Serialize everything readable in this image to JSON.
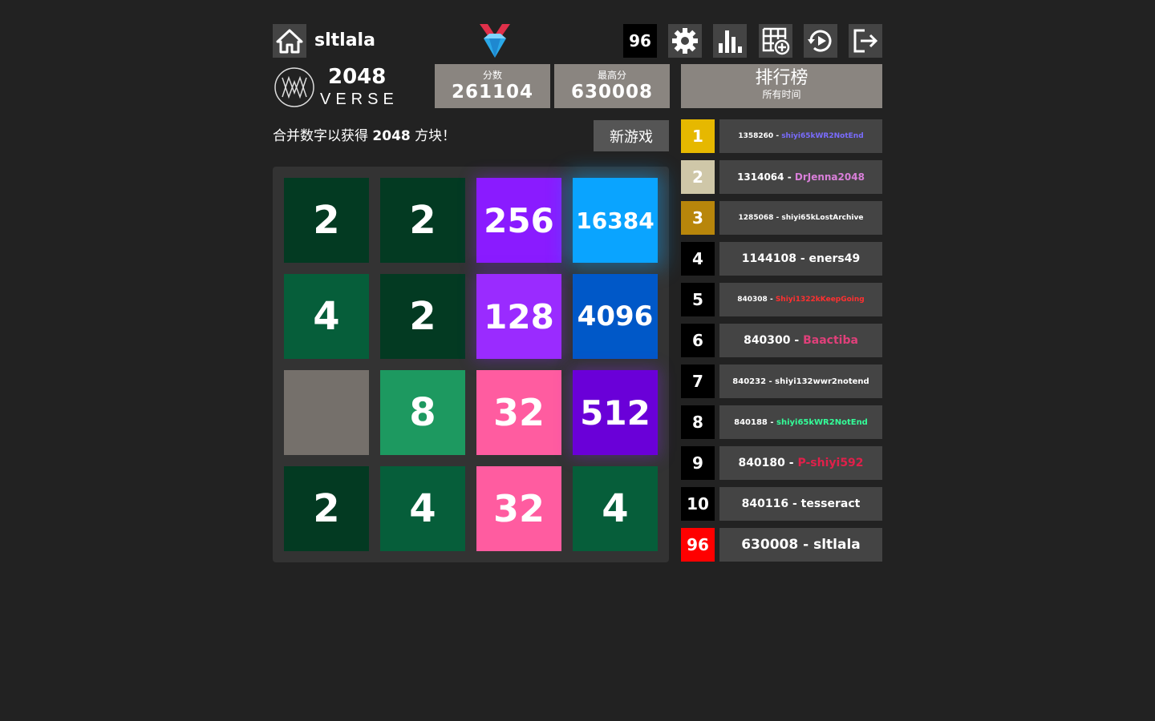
{
  "header": {
    "username": "sltlala",
    "rank_badge": "96",
    "icons": [
      "home-icon",
      "medal-diamond-icon",
      "gear-icon",
      "stats-bars-icon",
      "grid-add-icon",
      "replay-icon",
      "logout-icon"
    ]
  },
  "logo": {
    "line1": "2048",
    "line2": "VERSE"
  },
  "score": {
    "label": "分数",
    "value": "261104"
  },
  "best": {
    "label": "最高分",
    "value": "630008"
  },
  "leaderboard": {
    "title": "排行榜",
    "subtitle": "所有时间",
    "entries": [
      {
        "rank": "1",
        "score": "1358260 - ",
        "name": "shiyi65kWR2NotEnd",
        "rank_bg": "#e6b800",
        "name_color": "#7a6cff",
        "size": 9
      },
      {
        "rank": "2",
        "score": "1314064 - ",
        "name": "DrJenna2048",
        "rank_bg": "#cfc7a8",
        "name_color": "#d97fd9",
        "size": 12
      },
      {
        "rank": "3",
        "score": "1285068 - ",
        "name": "shiyi65kLostArchive",
        "rank_bg": "#b8860b",
        "name_color": "#ffffff",
        "size": 9
      },
      {
        "rank": "4",
        "score": "1144108 - ",
        "name": "eners49",
        "rank_bg": "#000000",
        "name_color": "#ffffff",
        "size": 14
      },
      {
        "rank": "5",
        "score": "840308 - ",
        "name": "Shiyi1322kKeepGoing",
        "rank_bg": "#000000",
        "name_color": "#ff3030",
        "size": 9
      },
      {
        "rank": "6",
        "score": "840300 - ",
        "name": "Baactiba",
        "rank_bg": "#000000",
        "name_color": "#e0407a",
        "size": 14
      },
      {
        "rank": "7",
        "score": "840232 - ",
        "name": "shiyi132wwr2notend",
        "rank_bg": "#000000",
        "name_color": "#ffffff",
        "size": 10
      },
      {
        "rank": "8",
        "score": "840188 - ",
        "name": "shiyi65kWR2NotEnd",
        "rank_bg": "#000000",
        "name_color": "#33ff99",
        "size": 10
      },
      {
        "rank": "9",
        "score": "840180 - ",
        "name": "P-shiyi592",
        "rank_bg": "#000000",
        "name_color": "#e0204a",
        "size": 14
      },
      {
        "rank": "10",
        "score": "840116 - ",
        "name": "tesseract",
        "rank_bg": "#000000",
        "name_color": "#ffffff",
        "size": 14
      },
      {
        "rank": "96",
        "score": "630008 - ",
        "name": "sltlala",
        "rank_bg": "#ff0000",
        "name_color": "#ffffff",
        "size": 17
      }
    ]
  },
  "intro": {
    "prefix": "合并数字以获得 ",
    "bold": "2048",
    "suffix": " 方块！"
  },
  "new_game_label": "新游戏",
  "board": [
    [
      "2",
      "2",
      "256",
      "16384"
    ],
    [
      "4",
      "2",
      "128",
      "4096"
    ],
    [
      "",
      "8",
      "32",
      "512"
    ],
    [
      "2",
      "4",
      "32",
      "4"
    ]
  ],
  "tile_colors": {
    "": "#75706b",
    "2": "#033a22",
    "4": "#065e3a",
    "8": "#1d9960",
    "32": "#ff5ca0",
    "128": "#9a2bff",
    "256": "#8a1bff",
    "512": "#6a00d8",
    "4096": "#0058c8",
    "16384": "#0aa4ff"
  }
}
